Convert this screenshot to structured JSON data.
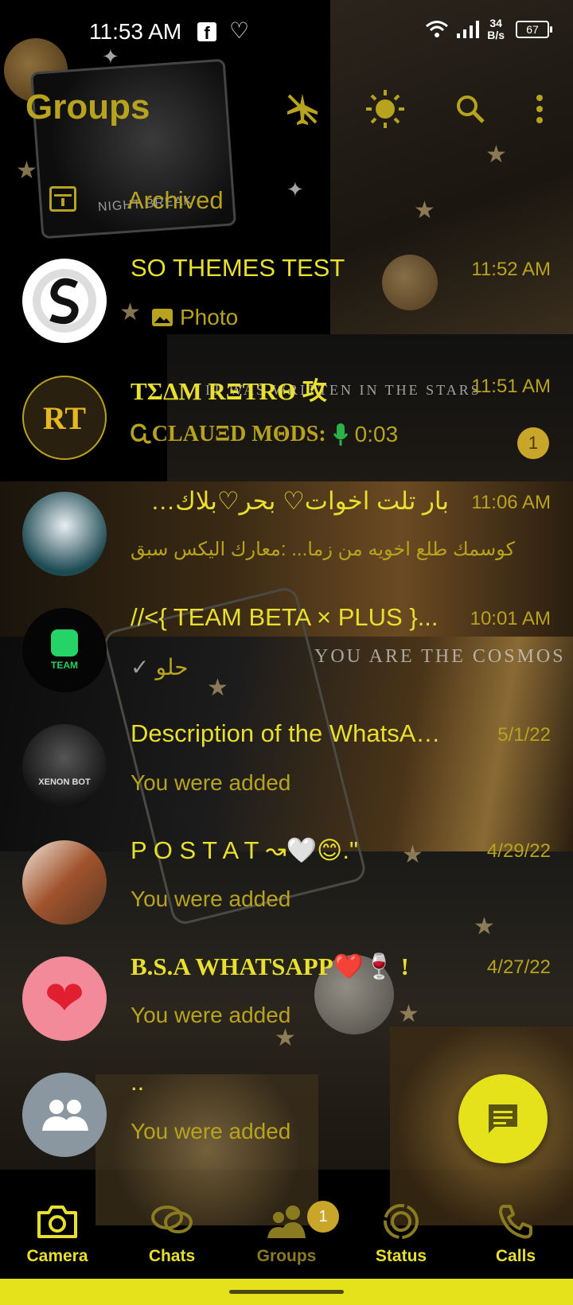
{
  "status_bar": {
    "time": "11:53 AM",
    "fb_glyph": "f",
    "net_speed_value": "34",
    "net_speed_unit": "B/s",
    "battery": "67"
  },
  "app_bar": {
    "title": "Groups",
    "archived_label": "Archived"
  },
  "chats": [
    {
      "name": "SO THEMES TEST",
      "time": "11:52 AM",
      "preview_icon": "photo-icon",
      "preview": "Photo",
      "avatar_color": "#ffffff",
      "avatar_text": "S"
    },
    {
      "name": "ΤΣΔΜ RΞTRΘ 攻",
      "time": "11:51 AM",
      "preview_sender": "ᏩCLAUΞD MΘDS: ",
      "preview": "0:03",
      "preview_icon": "mic-icon",
      "unread": "1",
      "avatar_color": "#2a2010",
      "avatar_text": "RT"
    },
    {
      "name": "بار تلت اخوات♡ بحر♡بلاك♡بح...",
      "time": "11:06 AM",
      "preview": "كوسمك طلع اخويه من زما... :معارك اليكس سبق",
      "avatar_color": "#1e3a3a",
      "avatar_text": ""
    },
    {
      "name": "//<{ TEAM BETA × PLUS }...",
      "time": "10:01 AM",
      "preview_icon": "check-icon",
      "preview": "حلو",
      "avatar_color": "#050505",
      "avatar_text": "TEAM"
    },
    {
      "name": "Description of the WhatsAp...",
      "time": "5/1/22",
      "preview": "You were added",
      "avatar_color": "#2a2a2a",
      "avatar_text": "XENON BOT"
    },
    {
      "name": "P O S T A T ↝🤍😊.\"",
      "time": "4/29/22",
      "preview": "You were added",
      "avatar_color": "#5a3a22",
      "avatar_text": ""
    },
    {
      "name": "B.S.A WHATSAPP❤️🍷 !",
      "time": "4/27/22",
      "preview": "You were added",
      "avatar_color": "#f28a9a",
      "avatar_text": "❤"
    },
    {
      "name": "..",
      "time": "",
      "preview": "You were added",
      "avatar_color": "#8a96a0",
      "avatar_text": ""
    }
  ],
  "bottom_nav": {
    "items": [
      {
        "label": "Camera",
        "icon": "camera-icon"
      },
      {
        "label": "Chats",
        "icon": "chats-icon"
      },
      {
        "label": "Groups",
        "icon": "groups-icon",
        "badge": "1"
      },
      {
        "label": "Status",
        "icon": "status-icon"
      },
      {
        "label": "Calls",
        "icon": "calls-icon"
      }
    ]
  },
  "background_texts": {
    "night_break": "NIGHT BREAK",
    "stars_quote": "IT WAS WRITTEN IN THE STARS",
    "cosmos_quote": "YOU ARE THE COSMOS"
  },
  "colors": {
    "accent": "#e8df2e",
    "accent_dim": "#b8a31e",
    "fab": "#e5e11a",
    "badge": "#c9a52a"
  }
}
